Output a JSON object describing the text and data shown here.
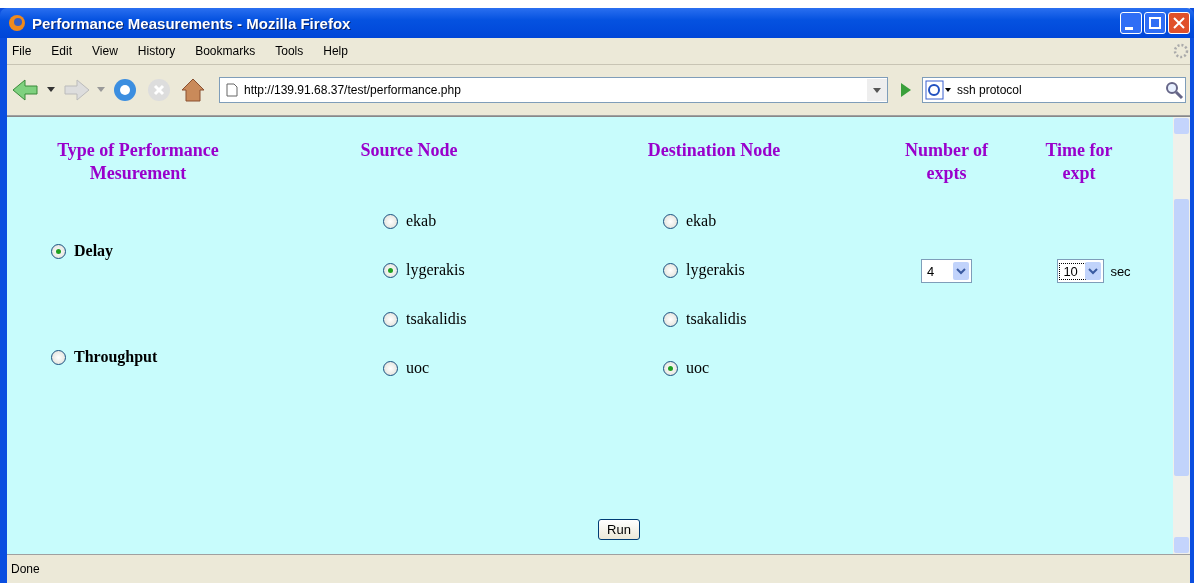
{
  "window": {
    "title": "Performance Measurements - Mozilla Firefox"
  },
  "menu": [
    "File",
    "Edit",
    "View",
    "History",
    "Bookmarks",
    "Tools",
    "Help"
  ],
  "address_bar": {
    "value": "http://139.91.68.37/test/performance.php"
  },
  "search_field": {
    "value": "ssh protocol"
  },
  "measurement": {
    "heading": "Type of Performance Mesurement",
    "options": [
      {
        "label": "Delay",
        "selected": true
      },
      {
        "label": "Throughput",
        "selected": false
      }
    ]
  },
  "source": {
    "heading": "Source Node",
    "options": [
      {
        "label": "ekab",
        "selected": false
      },
      {
        "label": "lygerakis",
        "selected": true
      },
      {
        "label": "tsakalidis",
        "selected": false
      },
      {
        "label": "uoc",
        "selected": false
      }
    ]
  },
  "destination": {
    "heading": "Destination Node",
    "options": [
      {
        "label": "ekab",
        "selected": false
      },
      {
        "label": "lygerakis",
        "selected": false
      },
      {
        "label": "tsakalidis",
        "selected": false
      },
      {
        "label": "uoc",
        "selected": true
      }
    ]
  },
  "number_of_expts": {
    "heading": "Number of expts",
    "value": "4"
  },
  "time_for_expt": {
    "heading": "Time for expt",
    "value": "10",
    "unit": "sec"
  },
  "run_button": "Run",
  "status_bar": "Done"
}
